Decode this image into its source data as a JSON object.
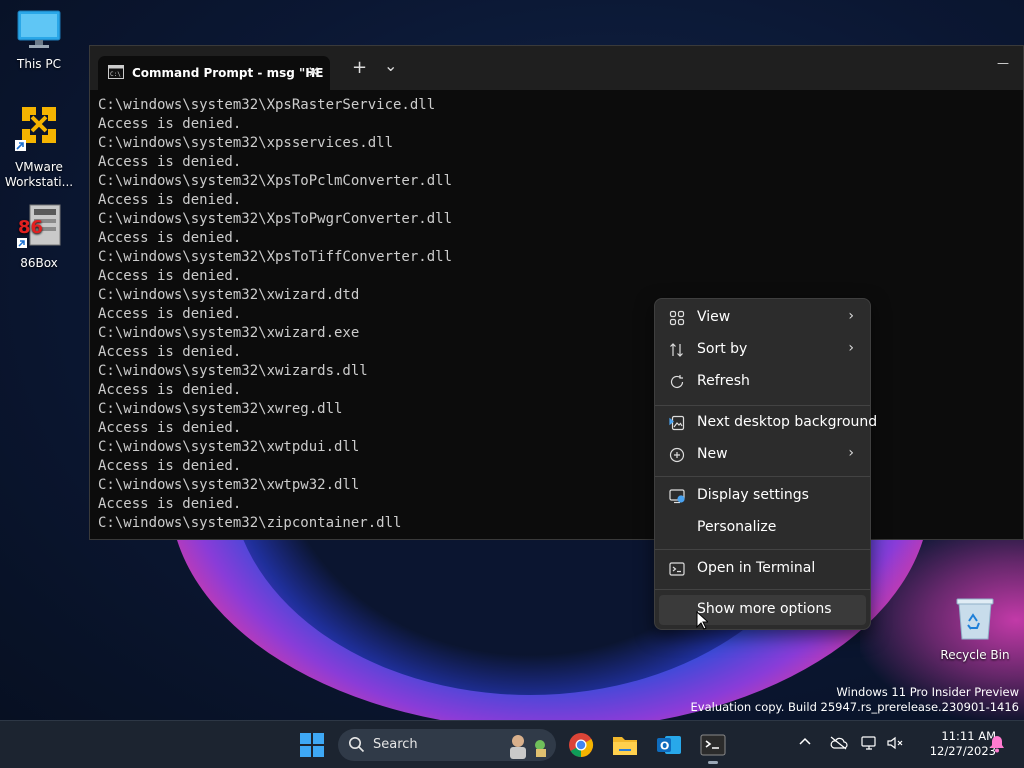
{
  "desktop": {
    "icons": [
      {
        "label": "This PC"
      },
      {
        "label": "VMware Workstati..."
      },
      {
        "label": "86Box"
      },
      {
        "label": "Recycle Bin"
      }
    ],
    "watermark": {
      "line1": "Windows 11 Pro Insider Preview",
      "line2": "Evaluation copy. Build 25947.rs_prerelease.230901-1416"
    }
  },
  "terminal": {
    "tab_title": "Command Prompt - msg  \"HE",
    "new_tab_symbol": "+",
    "dropdown_symbol": "⌄",
    "close_symbol": "✕",
    "minimize_symbol": "—",
    "lines": [
      "C:\\windows\\system32\\XpsRasterService.dll",
      "Access is denied.",
      "C:\\windows\\system32\\xpsservices.dll",
      "Access is denied.",
      "C:\\windows\\system32\\XpsToPclmConverter.dll",
      "Access is denied.",
      "C:\\windows\\system32\\XpsToPwgrConverter.dll",
      "Access is denied.",
      "C:\\windows\\system32\\XpsToTiffConverter.dll",
      "Access is denied.",
      "C:\\windows\\system32\\xwizard.dtd",
      "Access is denied.",
      "C:\\windows\\system32\\xwizard.exe",
      "Access is denied.",
      "C:\\windows\\system32\\xwizards.dll",
      "Access is denied.",
      "C:\\windows\\system32\\xwreg.dll",
      "Access is denied.",
      "C:\\windows\\system32\\xwtpdui.dll",
      "Access is denied.",
      "C:\\windows\\system32\\xwtpw32.dll",
      "Access is denied.",
      "C:\\windows\\system32\\zipcontainer.dll"
    ]
  },
  "context_menu": {
    "items": [
      {
        "label": "View",
        "icon": "grid-icon",
        "submenu": true
      },
      {
        "label": "Sort by",
        "icon": "sort-icon",
        "submenu": true
      },
      {
        "label": "Refresh",
        "icon": "refresh-icon",
        "submenu": false
      },
      {
        "label": "Next desktop background",
        "icon": "image-next-icon",
        "submenu": false
      },
      {
        "label": "New",
        "icon": "plus-circle-icon",
        "submenu": true
      },
      {
        "label": "Display settings",
        "icon": "display-icon",
        "submenu": false
      },
      {
        "label": "Personalize",
        "icon": "brush-icon",
        "submenu": false
      },
      {
        "label": "Open in Terminal",
        "icon": "terminal-icon",
        "submenu": false
      },
      {
        "label": "Show more options",
        "icon": "",
        "submenu": false
      }
    ],
    "arrow": "›"
  },
  "taskbar": {
    "search_label": "Search",
    "clock_time": "11:11 AM",
    "clock_date": "12/27/2023"
  },
  "colors": {
    "menu_bg": "#2c2c2c",
    "terminal_bg": "#0c0c0c",
    "taskbar_bg": "#1c2430",
    "accent": "#0078d4"
  }
}
